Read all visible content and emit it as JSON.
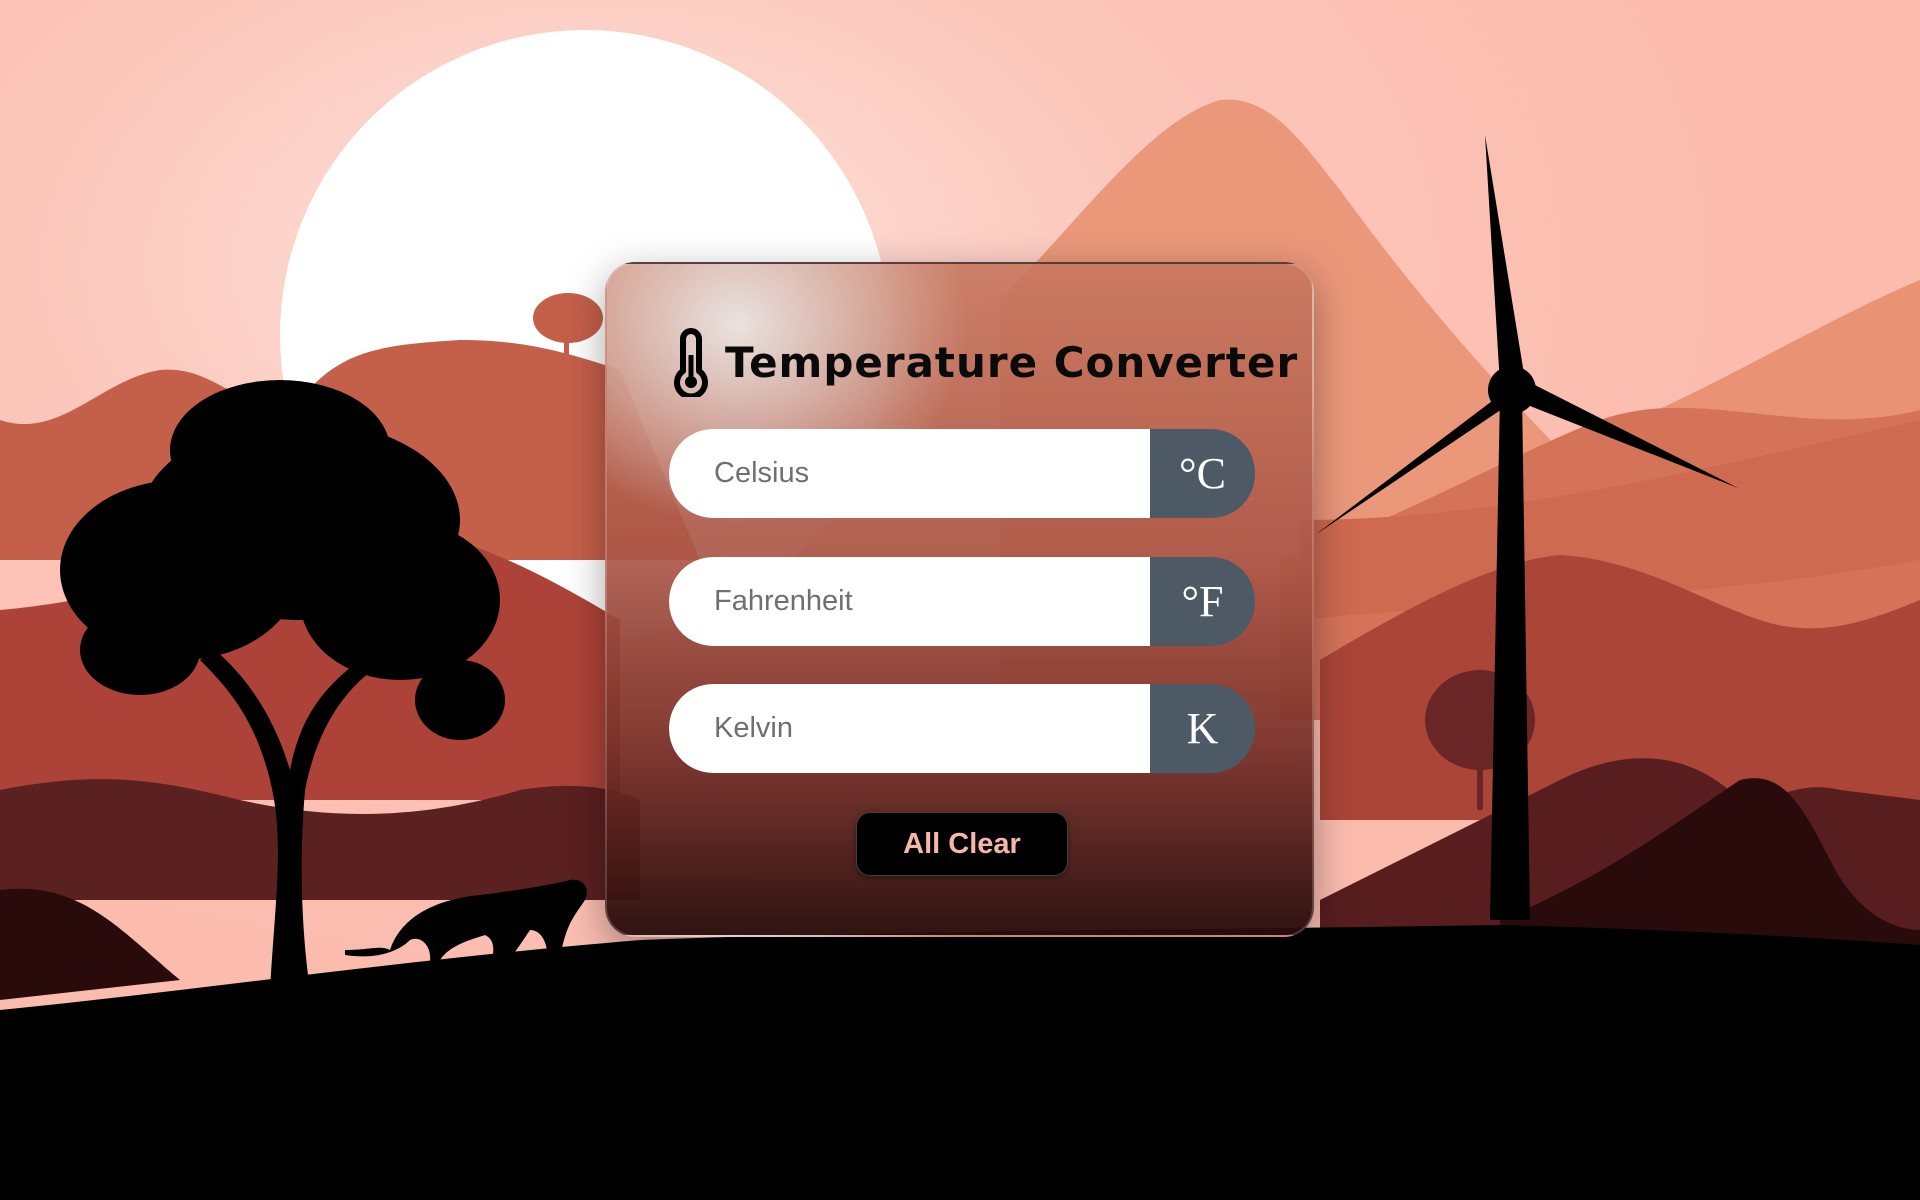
{
  "app": {
    "title": "Temperature Converter",
    "icon": "thermometer-icon"
  },
  "fields": [
    {
      "placeholder": "Celsius",
      "value": "",
      "unit": "°C"
    },
    {
      "placeholder": "Fahrenheit",
      "value": "",
      "unit": "°F"
    },
    {
      "placeholder": "Kelvin",
      "value": "",
      "unit": "K"
    }
  ],
  "actions": {
    "clear_label": "All Clear"
  },
  "colors": {
    "unit_bg": "#4d5a66",
    "button_bg": "#000000",
    "button_text": "#f7b7a8",
    "sky": "#fcbdb0"
  }
}
